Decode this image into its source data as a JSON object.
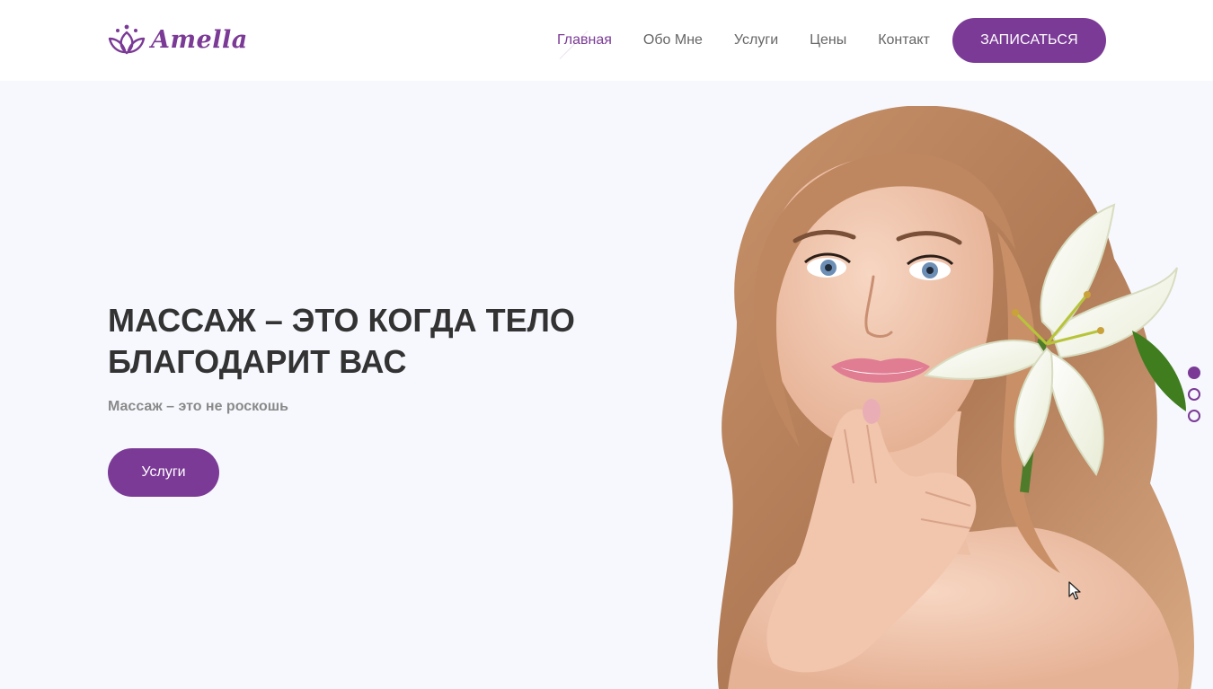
{
  "brand": {
    "name": "Amella",
    "logo_icon": "lotus-icon",
    "color": "#7b3a96"
  },
  "nav": {
    "items": [
      {
        "label": "Главная",
        "active": true
      },
      {
        "label": "Обо Мне",
        "active": false
      },
      {
        "label": "Услуги",
        "active": false
      },
      {
        "label": "Цены",
        "active": false
      },
      {
        "label": "Контакт",
        "active": false
      }
    ],
    "cta_label": "ЗАПИСАТЬСЯ"
  },
  "hero": {
    "title_line1": "МАССАЖ – ЭТО КОГДА ТЕЛО",
    "title_line2": "БЛАГОДАРИТ ВАС",
    "subtitle": "Массаж – это не роскошь",
    "button_label": "Услуги",
    "background_color": "#f6f8fd",
    "slides_total": 3,
    "active_slide": 1
  },
  "colors": {
    "accent": "#7b3a96",
    "title": "#333333",
    "nav_text": "#666666",
    "subtitle": "#8a8a8a"
  }
}
